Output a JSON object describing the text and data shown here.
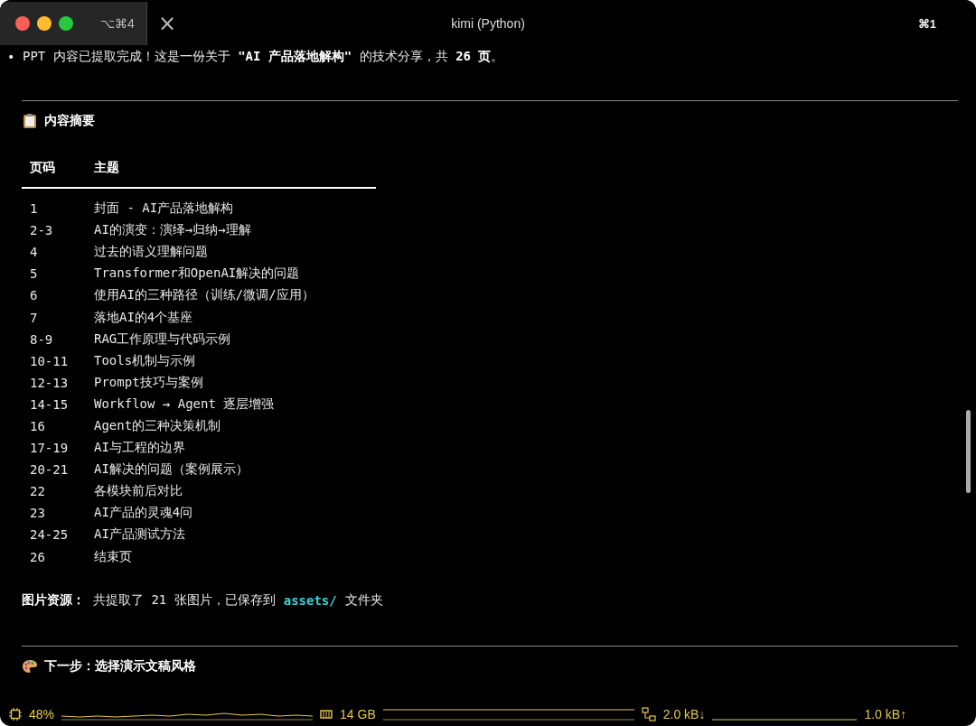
{
  "window": {
    "title": "kimi (Python)",
    "tab_shortcut": "⌥⌘4",
    "close_glyph": "×",
    "window_shortcut": "⌘1"
  },
  "intro": {
    "bullet": "•",
    "text": "PPT 内容已提取完成！这是一份关于 **\"AI 产品落地解构\"** 的技术分享，共 **26 页**。"
  },
  "summary": {
    "title": "内容摘要",
    "columns": [
      "页码",
      "主题"
    ],
    "rows": [
      {
        "page": "1",
        "topic": "封面 - AI产品落地解构"
      },
      {
        "page": "2-3",
        "topic": "AI的演变：演绎→归纳→理解"
      },
      {
        "page": "4",
        "topic": "过去的语义理解问题"
      },
      {
        "page": "5",
        "topic": "Transformer和OpenAI解决的问题"
      },
      {
        "page": "6",
        "topic": "使用AI的三种路径（训练/微调/应用）"
      },
      {
        "page": "7",
        "topic": "落地AI的4个基座"
      },
      {
        "page": "8-9",
        "topic": "RAG工作原理与代码示例"
      },
      {
        "page": "10-11",
        "topic": "Tools机制与示例"
      },
      {
        "page": "12-13",
        "topic": "Prompt技巧与案例"
      },
      {
        "page": "14-15",
        "topic": "Workflow → Agent 逐层增强"
      },
      {
        "page": "16",
        "topic": "Agent的三种决策机制"
      },
      {
        "page": "17-19",
        "topic": "AI与工程的边界"
      },
      {
        "page": "20-21",
        "topic": "AI解决的问题（案例展示）"
      },
      {
        "page": "22",
        "topic": "各模块前后对比"
      },
      {
        "page": "23",
        "topic": "AI产品的灵魂4问"
      },
      {
        "page": "24-25",
        "topic": "AI产品测试方法"
      },
      {
        "page": "26",
        "topic": "结束页"
      }
    ]
  },
  "resources": [
    {
      "kind": "label",
      "text": "图片资源："
    },
    {
      "kind": "plain",
      "text": "共提取了 21 张图片，已保存到"
    },
    {
      "kind": "path",
      "text": "assets/"
    },
    {
      "kind": "plain",
      "text": "文件夹"
    }
  ],
  "next_step": {
    "title": "下一步：选择演示文稿风格"
  },
  "status_bar": {
    "cpu": "48%",
    "memory": "14 GB",
    "download": "2.0 kB↓",
    "upload": "1.0 kB↑"
  }
}
